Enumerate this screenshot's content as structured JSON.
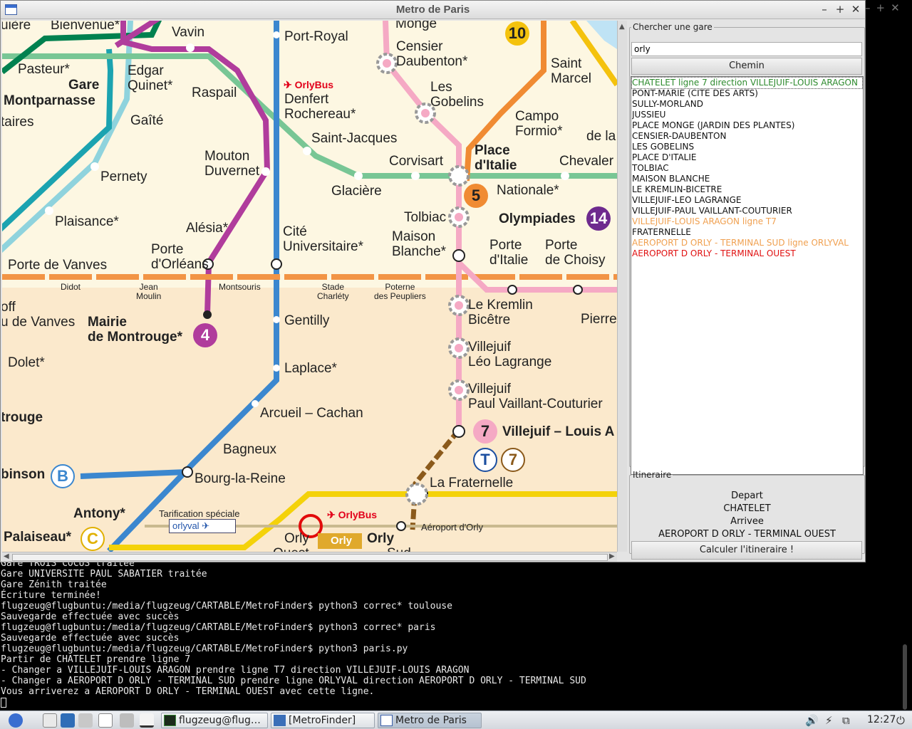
{
  "window": {
    "title": "Metro de Paris",
    "controls": [
      "–",
      "+",
      "✕"
    ]
  },
  "map": {
    "labels": [
      {
        "t": "uière"
      },
      {
        "t": "Bienvenüe*"
      },
      {
        "t": "Vavin"
      },
      {
        "t": "Port-Royal"
      },
      {
        "t": "Monge"
      },
      {
        "t": "Censier\nDaubenton*"
      },
      {
        "t": "Saint\nMarcel"
      },
      {
        "t": "Pasteur*"
      },
      {
        "t": "Edgar\nQuinet*"
      },
      {
        "t": "Gare"
      },
      {
        "t": "Montparnasse"
      },
      {
        "t": "Raspail"
      },
      {
        "t": "Denfert\nRochereau*"
      },
      {
        "t": "Les\nGobelins"
      },
      {
        "t": "Campo\nFormio*"
      },
      {
        "t": "de la"
      },
      {
        "t": "taires"
      },
      {
        "t": "Gaîté"
      },
      {
        "t": "Saint-Jacques"
      },
      {
        "t": "Place\nd'Italie"
      },
      {
        "t": "Mouton\nDuvernet"
      },
      {
        "t": "Pernety"
      },
      {
        "t": "Corvisart"
      },
      {
        "t": "Chevaler"
      },
      {
        "t": "Glacière"
      },
      {
        "t": "Nationale*"
      },
      {
        "t": "Tolbiac"
      },
      {
        "t": "Olympiades"
      },
      {
        "t": "Plaisance*"
      },
      {
        "t": "Alésia*"
      },
      {
        "t": "Cité\nUniversitaire*"
      },
      {
        "t": "Maison\nBlanche*"
      },
      {
        "t": "Porte\nd'Orléans"
      },
      {
        "t": "Porte de Vanves"
      },
      {
        "t": "Porte\nd'Italie"
      },
      {
        "t": "Porte\nde Choisy"
      },
      {
        "t": "Didot"
      },
      {
        "t": "Jean\nMoulin"
      },
      {
        "t": "Montsouris"
      },
      {
        "t": "Stade\nCharléty"
      },
      {
        "t": "Poterne\ndes Peupliers"
      },
      {
        "t": "off"
      },
      {
        "t": "u de Vanves"
      },
      {
        "t": "Mairie\nde Montrouge*"
      },
      {
        "t": "Gentilly"
      },
      {
        "t": "Le Kremlin\nBicêtre"
      },
      {
        "t": "Pierre"
      },
      {
        "t": "Villejuif\nLéo Lagrange"
      },
      {
        "t": "Dolet*"
      },
      {
        "t": "Laplace*"
      },
      {
        "t": "Villejuif\nPaul Vaillant-Couturier"
      },
      {
        "t": "trouge"
      },
      {
        "t": "Arcueil – Cachan"
      },
      {
        "t": "Villejuif – Louis A"
      },
      {
        "t": "Bagneux"
      },
      {
        "t": "binson"
      },
      {
        "t": "Bourg-la-Reine"
      },
      {
        "t": "La Fraternelle"
      },
      {
        "t": "Antony*"
      },
      {
        "t": "Tarification spéciale"
      },
      {
        "t": "Aéroport d'Orly"
      },
      {
        "t": "Palaiseau*"
      },
      {
        "t": "Orly"
      },
      {
        "t": "Orly"
      },
      {
        "t": "Ouest"
      },
      {
        "t": "Sud"
      }
    ],
    "orlybus": "OrlyBus",
    "orlyval": "orlyval",
    "orly_tag": "Orly",
    "badges": [
      "10",
      "5",
      "14",
      "4",
      "7",
      "T",
      "7",
      "B",
      "C"
    ]
  },
  "search": {
    "legend": "Chercher une gare",
    "query": "orly",
    "button": "Chemin",
    "results": [
      {
        "text": "CHATELET ligne 7 direction VILLEJUIF-LOUIS ARAGON",
        "color": "#2e8b2e"
      },
      {
        "text": "PONT-MARIE (CITE DES ARTS)",
        "color": "#111111"
      },
      {
        "text": "SULLY-MORLAND",
        "color": "#111111"
      },
      {
        "text": "JUSSIEU",
        "color": "#111111"
      },
      {
        "text": "PLACE MONGE (JARDIN DES PLANTES)",
        "color": "#111111"
      },
      {
        "text": "CENSIER-DAUBENTON",
        "color": "#111111"
      },
      {
        "text": "LES GOBELINS",
        "color": "#111111"
      },
      {
        "text": "PLACE D'ITALIE",
        "color": "#111111"
      },
      {
        "text": "TOLBIAC",
        "color": "#111111"
      },
      {
        "text": "MAISON BLANCHE",
        "color": "#111111"
      },
      {
        "text": "LE KREMLIN-BICETRE",
        "color": "#111111"
      },
      {
        "text": "VILLEJUIF-LEO LAGRANGE",
        "color": "#111111"
      },
      {
        "text": "VILLEJUIF-PAUL VAILLANT-COUTURIER",
        "color": "#111111"
      },
      {
        "text": "VILLEJUIF-LOUIS ARAGON ligne T7",
        "color": "#f0a050"
      },
      {
        "text": "FRATERNELLE",
        "color": "#111111"
      },
      {
        "text": "AEROPORT D ORLY - TERMINAL SUD ligne ORLYVAL",
        "color": "#f0a050"
      },
      {
        "text": "AEROPORT D ORLY - TERMINAL OUEST",
        "color": "#e01010"
      }
    ]
  },
  "itinerary": {
    "legend": "Itineraire",
    "depart_label": "Depart",
    "depart_value": "CHATELET",
    "arrivee_label": "Arrivee",
    "arrivee_value": "AEROPORT D ORLY - TERMINAL OUEST",
    "button": "Calculer l'itineraire !"
  },
  "terminal": {
    "lines": [
      "Gare TROIS COCUS traitée",
      "Gare UNIVERSITE PAUL SABATIER traitée",
      "Gare Zénith traitée",
      "Écriture terminée!",
      "flugzeug@flugbuntu:/media/flugzeug/CARTABLE/MetroFinder$ python3 correc* toulouse",
      "Sauvegarde effectuée avec succès",
      "flugzeug@flugbuntu:/media/flugzeug/CARTABLE/MetroFinder$ python3 correc* paris",
      "Sauvegarde effectuée avec succès",
      "flugzeug@flugbuntu:/media/flugzeug/CARTABLE/MetroFinder$ python3 paris.py",
      "Partir de CHATELET prendre ligne 7",
      "- Changer a VILLEJUIF-LOUIS ARAGON prendre ligne T7 direction VILLEJUIF-LOUIS ARAGON",
      "- Changer a AEROPORT D ORLY - TERMINAL SUD prendre ligne ORLYVAL direction AEROPORT D ORLY - TERMINAL SUD",
      "Vous arriverez a AEROPORT D ORLY - TERMINAL OUEST avec cette ligne."
    ]
  },
  "taskbar": {
    "tasks": [
      {
        "label": "flugzeug@flug…",
        "icon": "terminal-icon"
      },
      {
        "label": "[MetroFinder]",
        "icon": "folder-icon"
      },
      {
        "label": "Metro de Paris",
        "icon": "window-icon"
      }
    ],
    "clock": "12:27"
  }
}
